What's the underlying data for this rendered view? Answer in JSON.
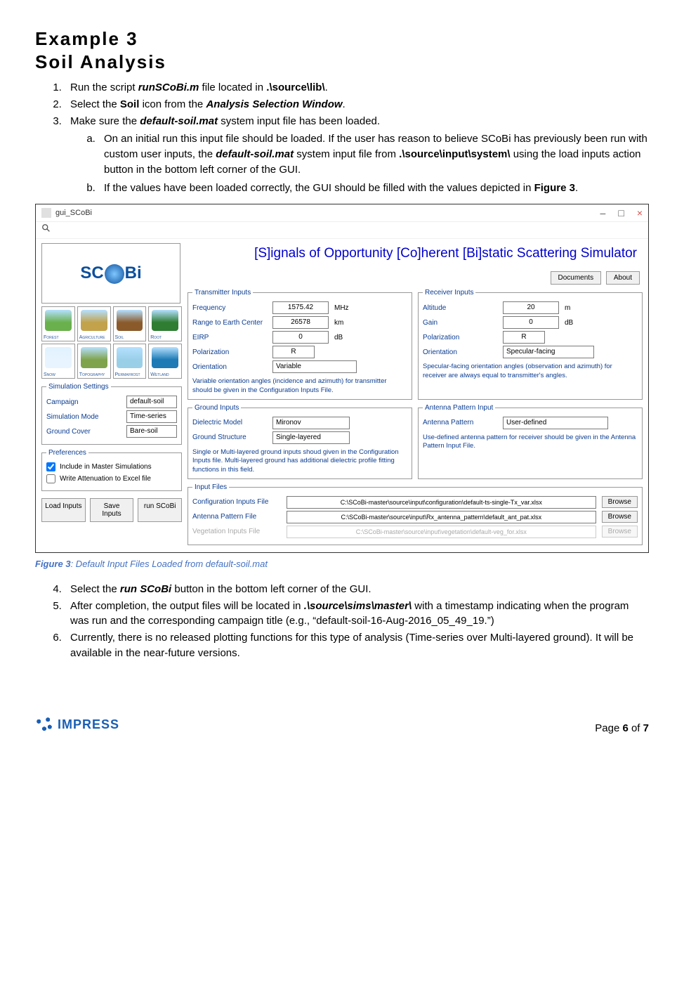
{
  "heading1": "Example 3",
  "heading2": "Soil Analysis",
  "list": {
    "i1_a": "Run the script ",
    "i1_b": "runSCoBi.m",
    "i1_c": " file located in ",
    "i1_d": ".\\source\\lib\\",
    "i1_e": ".",
    "i2_a": "Select the ",
    "i2_b": "Soil",
    "i2_c": " icon from the ",
    "i2_d": "Analysis Selection Window",
    "i2_e": ".",
    "i3_a": "Make sure the ",
    "i3_b": "default-soil.mat",
    "i3_c": " system input file has been loaded.",
    "i3a_a": "On an initial run this input file should be loaded. If the user has reason to believe SCoBi has previously been run with custom user inputs, the ",
    "i3a_b": "default-soil.mat",
    "i3a_c": " system input file from ",
    "i3a_d": ".\\source\\input\\system\\",
    "i3a_e": " using the load inputs action button in the bottom left corner of the GUI.",
    "i3b_a": "If the values have been loaded correctly, the GUI should be filled with the values depicted in ",
    "i3b_b": "Figure 3",
    "i3b_c": ".",
    "i4_a": "Select the ",
    "i4_b": "run SCoBi",
    "i4_c": " button in the bottom left corner of the GUI.",
    "i5_a": "After completion, the output files will be located in ",
    "i5_b": ".\\source\\sims\\master\\",
    "i5_c": " with a timestamp indicating when the program was run and the corresponding campaign title (e.g., “default-soil-16-Aug-2016_05_49_19.”)",
    "i6": "Currently, there is no released plotting functions for this type of analysis (Time-series over Multi-layered ground). It will be available in the near-future versions."
  },
  "caption_label": "Figure 3",
  "caption_text": ": Default Input Files Loaded from default-soil.mat",
  "win": {
    "title": "gui_SCoBi",
    "min": "–",
    "max": "□",
    "close": "×"
  },
  "app": {
    "title": "[S]ignals of Opportunity [Co]herent [Bi]static Scattering Simulator",
    "documents": "Documents",
    "about": "About",
    "logo": "SC",
    "logo2": "Bi",
    "icons": [
      "Forest",
      "Agriculture",
      "Soil",
      "Root",
      "Snow",
      "Topography",
      "Permafrost",
      "Wetland"
    ]
  },
  "sim": {
    "legend": "Simulation Settings",
    "campaign_l": "Campaign",
    "campaign_v": "default-soil",
    "mode_l": "Simulation Mode",
    "mode_v": "Time-series",
    "cover_l": "Ground Cover",
    "cover_v": "Bare-soil"
  },
  "pref": {
    "legend": "Preferences",
    "c1": "Include in Master Simulations",
    "c2": "Write Attenuation to Excel file"
  },
  "btns": {
    "load": "Load Inputs",
    "save": "Save Inputs",
    "run": "run SCoBi"
  },
  "tx": {
    "legend": "Transmitter Inputs",
    "freq_l": "Frequency",
    "freq_v": "1575.42",
    "freq_u": "MHz",
    "range_l": "Range to Earth Center",
    "range_v": "26578",
    "range_u": "km",
    "eirp_l": "EIRP",
    "eirp_v": "0",
    "eirp_u": "dB",
    "pol_l": "Polarization",
    "pol_v": "R",
    "ori_l": "Orientation",
    "ori_v": "Variable",
    "note": "Variable orientation angles (incidence and azimuth) for transmitter should be given in the Configuration Inputs File."
  },
  "rx": {
    "legend": "Receiver Inputs",
    "alt_l": "Altitude",
    "alt_v": "20",
    "alt_u": "m",
    "gain_l": "Gain",
    "gain_v": "0",
    "gain_u": "dB",
    "pol_l": "Polarization",
    "pol_v": "R",
    "ori_l": "Orientation",
    "ori_v": "Specular-facing",
    "note": "Specular-facing orientation angles (observation and azimuth) for receiver are always equal to transmitter's angles."
  },
  "ant": {
    "legend": "Antenna Pattern Input",
    "pat_l": "Antenna Pattern",
    "pat_v": "User-defined",
    "note": "Use-defined antenna pattern for receiver should be given in the Antenna Pattern Input File."
  },
  "gnd": {
    "legend": "Ground Inputs",
    "diel_l": "Dielectric Model",
    "diel_v": "Mironov",
    "struct_l": "Ground Structure",
    "struct_v": "Single-layered",
    "note": "Single or Multi-layered ground inputs shoud given in the Configuration Inputs file. Multi-layered ground has additional dielectric profile fitting functions in this field."
  },
  "inp": {
    "legend": "Input Files",
    "cfg_l": "Configuration Inputs File",
    "cfg_v": "C:\\SCoBi-master\\source\\input\\configuration\\default-ts-single-Tx_var.xlsx",
    "ant_l": "Antenna Pattern File",
    "ant_v": "C:\\SCoBi-master\\source\\input\\Rx_antenna_pattern\\default_ant_pat.xlsx",
    "veg_l": "Vegetation Inputs File",
    "veg_v": "C:\\SCoBi-master\\source\\input\\vegetation\\default-veg_for.xlsx",
    "browse": "Browse"
  },
  "footer": {
    "logo": "IMPRESS",
    "page_a": "Page ",
    "page_b": "6",
    "page_c": " of ",
    "page_d": "7"
  }
}
